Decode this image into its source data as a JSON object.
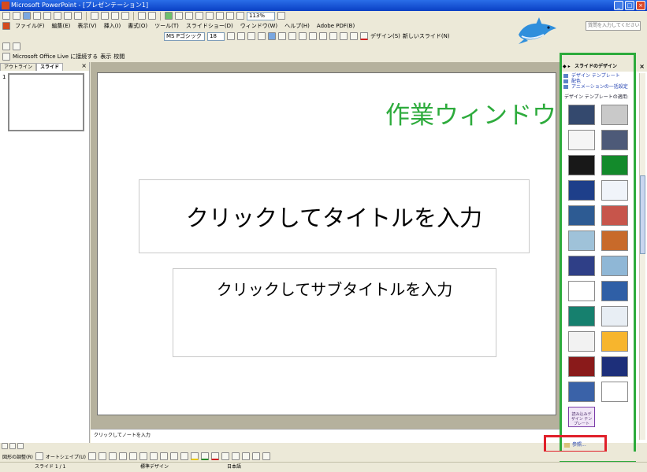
{
  "window": {
    "title": "Microsoft PowerPoint - [プレゼンテーション1]",
    "min_glyph": "_",
    "max_glyph": "□",
    "close_glyph": "×"
  },
  "menu": [
    "ファイル(F)",
    "編集(E)",
    "表示(V)",
    "挿入(I)",
    "書式(O)",
    "ツール(T)",
    "スライドショー(D)",
    "ウィンドウ(W)",
    "ヘルプ(H)",
    "Adobe PDF(B)"
  ],
  "standard_toolbar": {
    "zoom": "113%"
  },
  "format_toolbar": {
    "font_name": "MS Pゴシック",
    "font_size": "18",
    "design_label": "デザイン(S)",
    "new_slide_label": "新しいスライド(N)"
  },
  "help_box_placeholder": "質問を入力してください",
  "meeting_toolbar": {
    "label": "Microsoft Office Live に接続する",
    "review_label": "表示",
    "other_label": "校閲"
  },
  "left_pane": {
    "tabs": [
      "アウトライン",
      "スライド"
    ],
    "slide_number": "1",
    "close_glyph": "×"
  },
  "slide": {
    "title_placeholder": "クリックしてタイトルを入力",
    "subtitle_placeholder": "クリックしてサブタイトルを入力"
  },
  "annotation": "作業ウィンドウ",
  "notes_placeholder": "クリックしてノートを入力",
  "task_pane": {
    "nav": "◆ ▸",
    "title": "スライドのデザイン",
    "close_glyph": "×",
    "links": [
      "デザイン テンプレート",
      "配色",
      "アニメーションの一括設定"
    ],
    "section_title": "デザイン テンプレートの適用:",
    "templates": [
      {
        "bg": "#34496e"
      },
      {
        "bg": "#c9c9c9"
      },
      {
        "bg": "#f5f5f5"
      },
      {
        "bg": "#4d5a78"
      },
      {
        "bg": "#181818"
      },
      {
        "bg": "#138a2b"
      },
      {
        "bg": "#1e3f8a"
      },
      {
        "bg": "#f0f4fa"
      },
      {
        "bg": "#2d5b93"
      },
      {
        "bg": "#c7554b"
      },
      {
        "bg": "#9fc2d9"
      },
      {
        "bg": "#c86a2a"
      },
      {
        "bg": "#2f3f87"
      },
      {
        "bg": "#8fb7d6"
      },
      {
        "bg": "#ffffff"
      },
      {
        "bg": "#2f5fa6"
      },
      {
        "bg": "#16806e"
      },
      {
        "bg": "#e8eef4"
      },
      {
        "bg": "#f2f2f2"
      },
      {
        "bg": "#f7b52d"
      },
      {
        "bg": "#8a1a1a"
      },
      {
        "bg": "#1d2f7a"
      },
      {
        "bg": "#3a62a8"
      },
      {
        "bg": "#ffffff"
      },
      {
        "bg": "#f1e6f7",
        "label": "読み込みデザイン テンプレート"
      }
    ],
    "browse_label": "参照..."
  },
  "drawing_toolbar": {
    "draw_label": "図形の調整(R)",
    "autoshape_label": "オートシェイプ(U)"
  },
  "status_bar": {
    "slide_position": "スライド 1 / 1",
    "design": "標準デザイン",
    "language": "日本語"
  }
}
